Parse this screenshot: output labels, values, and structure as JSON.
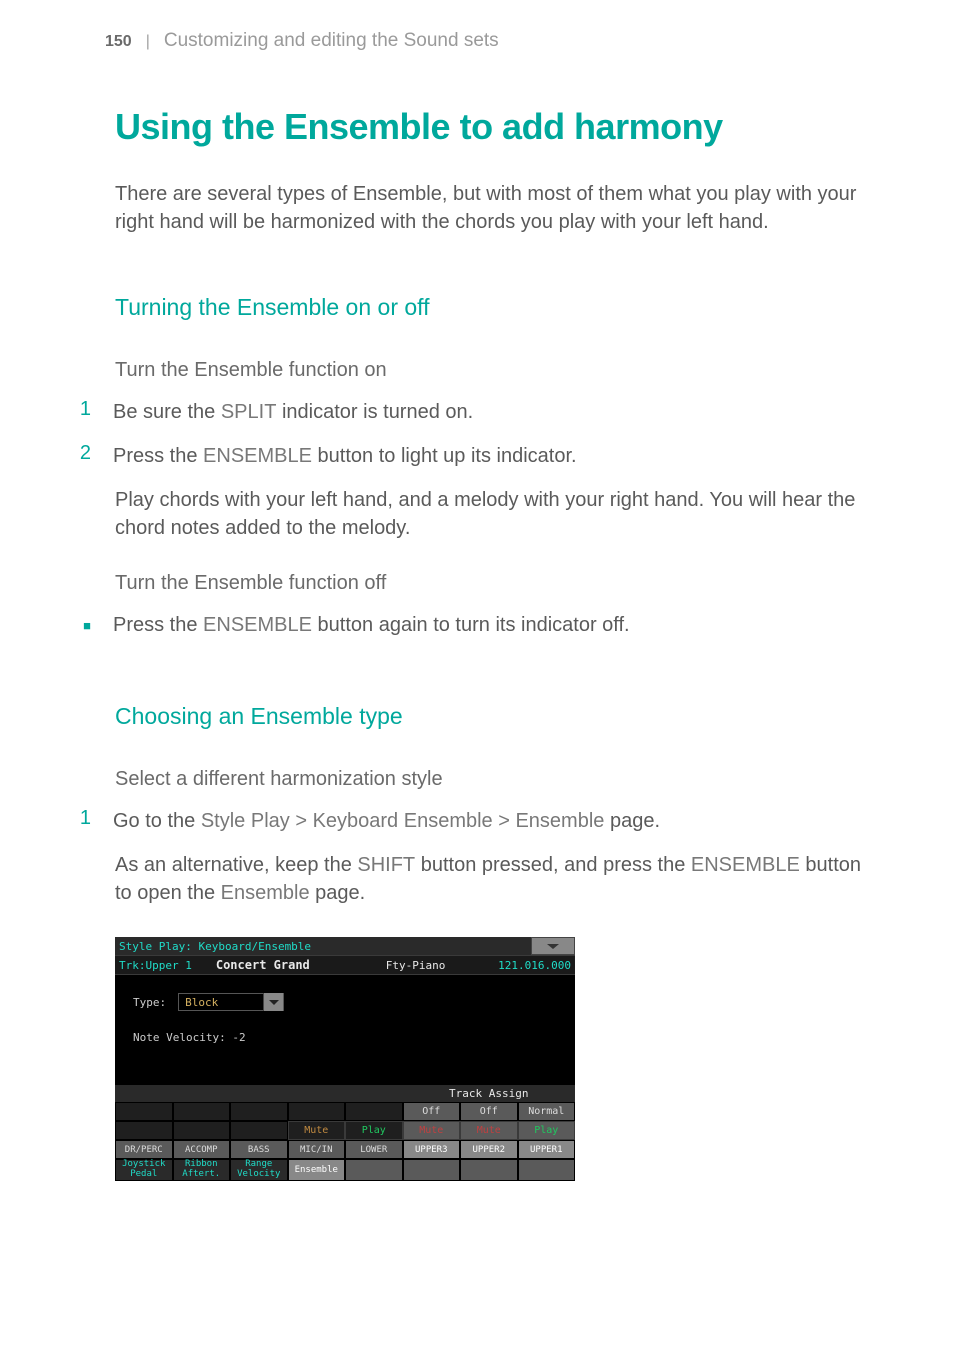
{
  "header": {
    "page_number": "150",
    "separator": "|",
    "section_name": "Customizing and editing the Sound sets"
  },
  "title": "Using the Ensemble to add harmony",
  "intro": "There are several types of Ensemble, but with most of them what you play with your right hand will be harmonized with the chords you play with your left hand.",
  "sub1": {
    "title": "Turning the Ensemble on or off",
    "heading_on": "Turn the Ensemble function on",
    "step1_pre": "Be sure the ",
    "step1_kw": "SPLIT",
    "step1_post": " indicator is turned on.",
    "step2_pre": "Press the ",
    "step2_kw": "ENSEMBLE",
    "step2_post": " button to light up its indicator.",
    "step2_body": "Play chords with your left hand, and a melody with your right hand. You will hear the chord notes added to the melody.",
    "heading_off": "Turn the Ensemble function off",
    "bullet_pre": "Press the ",
    "bullet_kw": "ENSEMBLE",
    "bullet_post": " button again to turn its indicator off."
  },
  "sub2": {
    "title": "Choosing an Ensemble type",
    "heading": "Select a different harmonization style",
    "step1_pre": "Go to the ",
    "step1_kw": "Style Play > Keyboard Ensemble > Ensemble",
    "step1_post": " page.",
    "body_pre": "As an alternative, keep the ",
    "body_kw1": "SHIFT",
    "body_mid": " button pressed, and press the ",
    "body_kw2": "ENSEMBLE",
    "body_mid2": " button to open the ",
    "body_kw3": "Ensemble",
    "body_post": " page."
  },
  "ui": {
    "titlebar": "Style Play: Keyboard/Ensemble",
    "trk": "Trk:Upper 1",
    "instrument": "Concert Grand",
    "fty": "Fty-Piano",
    "bank": "121.016.000",
    "type_label": "Type:",
    "type_value": "Block",
    "velocity": "Note Velocity: -2",
    "track_assign": "Track Assign",
    "row_assign": {
      "c5": "Off",
      "c6": "Off",
      "c7": "Normal"
    },
    "row_status": {
      "c3": "Mute",
      "c4": "Play",
      "c5": "Mute",
      "c6": "Mute",
      "c7": "Play"
    },
    "headers": [
      "DR/PERC",
      "ACCOMP",
      "BASS",
      "MIC/IN",
      "LOWER",
      "UPPER3",
      "UPPER2",
      "UPPER1"
    ],
    "tabs": {
      "t0": "Joystick Pedal",
      "t1": "Ribbon Aftert.",
      "t2": "Range Velocity",
      "t3": "Ensemble"
    }
  }
}
